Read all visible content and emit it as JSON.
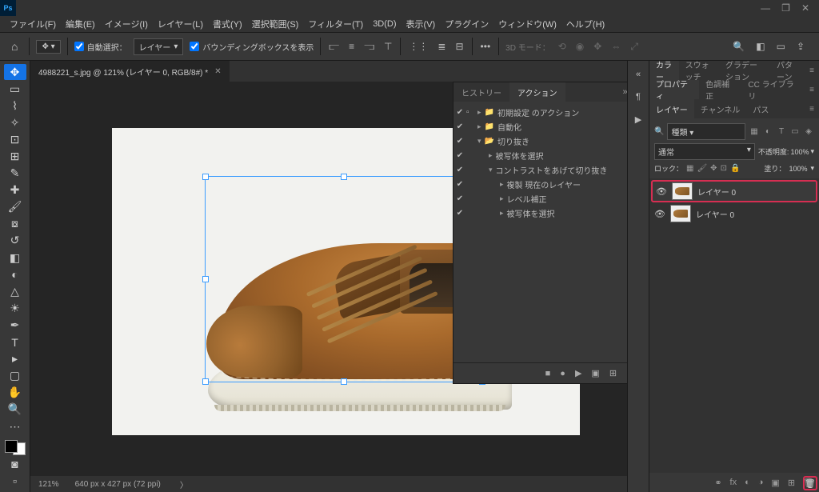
{
  "window": {
    "minimize": "—",
    "restore": "❐",
    "close": "✕"
  },
  "menu": {
    "file": "ファイル(F)",
    "edit": "編集(E)",
    "image": "イメージ(I)",
    "layer": "レイヤー(L)",
    "type": "書式(Y)",
    "select": "選択範囲(S)",
    "filter": "フィルター(T)",
    "threed": "3D(D)",
    "view": "表示(V)",
    "plugin": "プラグイン",
    "window": "ウィンドウ(W)",
    "help": "ヘルプ(H)"
  },
  "optbar": {
    "auto_select": "自動選択：",
    "layer_label": "レイヤー",
    "show_transform": "バウンディングボックスを表示",
    "threed_mode": "3D モード："
  },
  "doc": {
    "tab_title": "4988221_s.jpg @ 121% (レイヤー 0, RGB/8#) *"
  },
  "panels": {
    "history": "ヒストリー",
    "actions": "アクション",
    "color": "カラー",
    "swatch": "スウォッチ",
    "gradient": "グラデーション",
    "pattern": "パターン",
    "property": "プロパティ",
    "color_correct": "色調補正",
    "cc_lib": "CC ライブラリ",
    "layer": "レイヤー",
    "channel": "チャンネル",
    "path": "パス"
  },
  "actions": {
    "default": "初期設定 のアクション",
    "auto": "自動化",
    "cutout": "切り抜き",
    "select_subject": "被写体を選択",
    "contrast": "コントラストをあげて切り抜き",
    "dup_layer": "複製 現在のレイヤー",
    "level": "レベル補正",
    "select_subject2": "被写体を選択"
  },
  "layers": {
    "kind_label": "種類",
    "normal": "通常",
    "opacity_label": "不透明度:",
    "opacity_val": "100%",
    "lock_label": "ロック：",
    "fill_label": "塗り：",
    "fill_val": "100%",
    "layer0": "レイヤー 0",
    "layer0b": "レイヤー 0"
  },
  "status": {
    "zoom": "121%",
    "dims": "640 px x 427 px (72 ppi)"
  }
}
